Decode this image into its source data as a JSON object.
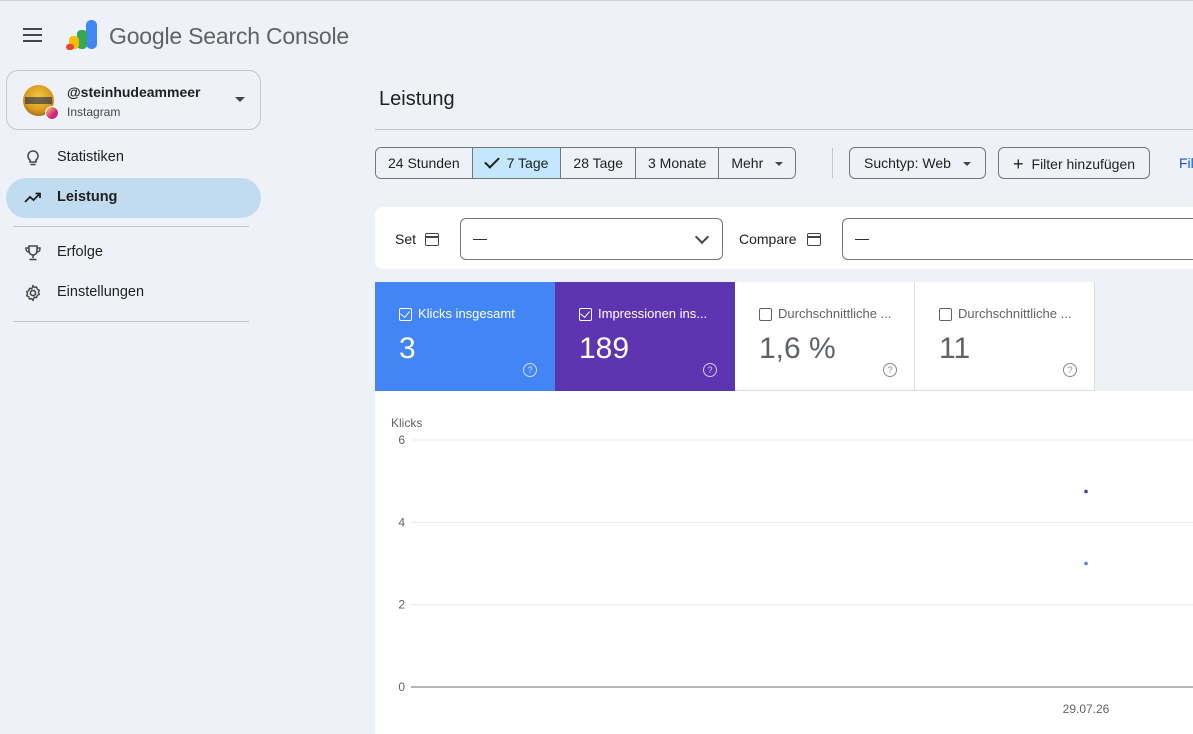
{
  "header": {
    "app_title": "Google Search Console"
  },
  "property": {
    "name": "@steinhudeammeer",
    "type": "Instagram"
  },
  "nav": {
    "items": [
      {
        "label": "Statistiken"
      },
      {
        "label": "Leistung"
      },
      {
        "label": "Erfolge"
      },
      {
        "label": "Einstellungen"
      }
    ]
  },
  "page": {
    "title": "Leistung"
  },
  "date_range": {
    "options": [
      "24 Stunden",
      "7 Tage",
      "28 Tage",
      "3 Monate",
      "Mehr"
    ],
    "selected": "7 Tage"
  },
  "filters": {
    "search_type": "Suchtyp: Web",
    "add_filter": "Filter hinzufügen",
    "cut_link": "Fil"
  },
  "compare": {
    "set_label": "Set",
    "set_value": "—",
    "compare_label": "Compare",
    "compare_value": "—"
  },
  "metrics": [
    {
      "label": "Klicks insgesamt",
      "value": "3",
      "checked": true,
      "color": "#4285f4"
    },
    {
      "label": "Impressionen ins...",
      "value": "189",
      "checked": true,
      "color": "#5e35b1"
    },
    {
      "label": "Durchschnittliche ...",
      "value": "1,6 %",
      "checked": false
    },
    {
      "label": "Durchschnittliche ...",
      "value": "11",
      "checked": false
    }
  ],
  "chart_data": {
    "type": "scatter",
    "ylabel": "Klicks",
    "ylim": [
      0,
      6
    ],
    "yticks": [
      "6",
      "4",
      "2",
      "0"
    ],
    "x": [
      "29.07.26"
    ],
    "series": [
      {
        "values": [
          3
        ],
        "color": "#4285f4"
      },
      {
        "values": [
          4.75
        ],
        "color": "#5e35b1"
      }
    ],
    "grid": true
  }
}
